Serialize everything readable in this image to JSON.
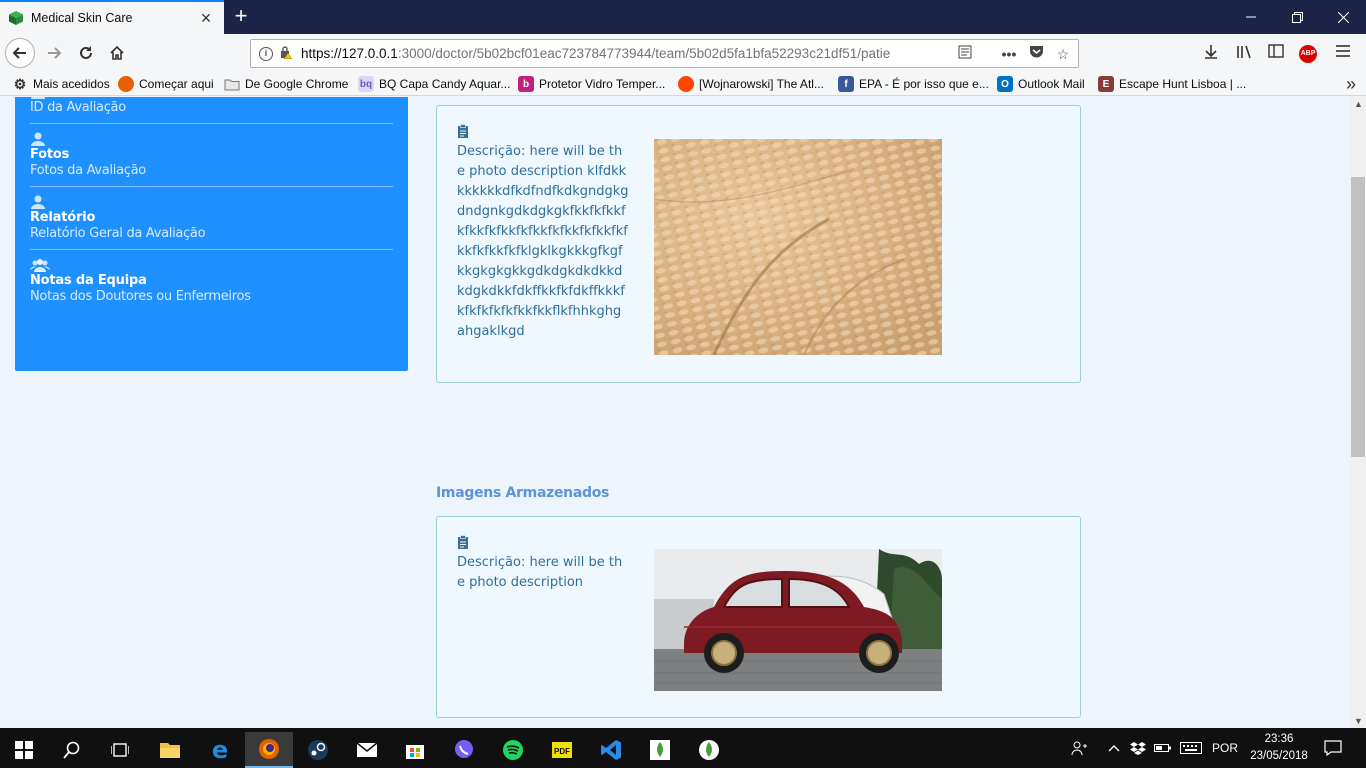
{
  "browser": {
    "tab_title": "Medical Skin Care",
    "new_tab_symbol": "+",
    "url_host": "https://127.0.0.1",
    "url_rest": ":3000/doctor/5b02bcf01eac723784773944/team/5b02d5fa1bfa52293c21df51/patie",
    "bookmarks": [
      {
        "label": "Mais acedidos",
        "icon": "gear-icon",
        "color": "#333333"
      },
      {
        "label": "Começar aqui",
        "icon": "firefox-icon",
        "color": "#e66000"
      },
      {
        "label": "De Google Chrome",
        "icon": "folder-icon",
        "color": "#8a8a8a"
      },
      {
        "label": "BQ Capa Candy Aquar...",
        "icon": "bq-icon",
        "color": "#6a5acd"
      },
      {
        "label": "Protetor Vidro Temper...",
        "icon": "bq-icon",
        "color": "#c02080"
      },
      {
        "label": "[Wojnarowski] The Atl...",
        "icon": "reddit-icon",
        "color": "#ff4500"
      },
      {
        "label": "EPA - É por isso que e...",
        "icon": "facebook-icon",
        "color": "#3b5998"
      },
      {
        "label": "Outlook Mail",
        "icon": "outlook-icon",
        "color": "#0072c6"
      },
      {
        "label": "Escape Hunt Lisboa | ...",
        "icon": "escape-hunt-icon",
        "color": "#8b3a3a"
      }
    ]
  },
  "sidebar": {
    "items": [
      {
        "title": "",
        "subtitle": "ID da Avaliação"
      },
      {
        "title": "Fotos",
        "subtitle": "Fotos da Avaliação"
      },
      {
        "title": "Relatório",
        "subtitle": "Relatório Geral da Avaliação"
      },
      {
        "title": "Notas da Equipa",
        "subtitle": "Notas dos Doutores ou Enfermeiros"
      }
    ]
  },
  "main": {
    "photo_card_1": {
      "description": "Descrição: here will be the photo description klfdkkkkkkkkdfkdfndfkdkgndgkgdndgnkgdkdgkgkfkkfkfkkfkfkkfkfkkfkfkkfkfkkfkfkkfkfkkfkfkkfkfklgklkgkkkgfkgfkkgkgkgkkgdkdgkdkdkkdkdgkdkkfdkffkkfkfdkffkkkfkfkfkfkfkfkkfkkflkfhhkghgahgaklkgd"
    },
    "section_title": "Imagens Armazenados",
    "photo_card_2": {
      "description": "Descrição: here will be the photo description"
    }
  },
  "taskbar": {
    "language": "POR",
    "time": "23:36",
    "date": "23/05/2018"
  },
  "colors": {
    "sidebar_bg": "#1e90ff",
    "accent": "#5b95d8",
    "card_border": "#9fcfcc"
  }
}
